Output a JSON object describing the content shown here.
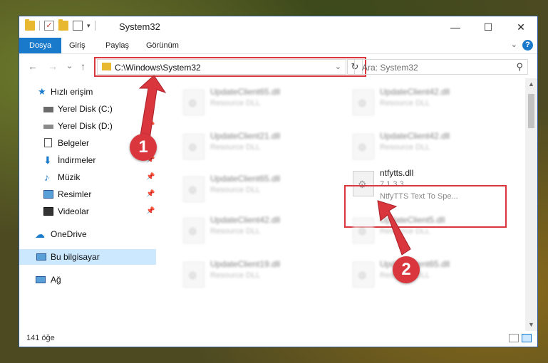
{
  "window": {
    "title": "System32"
  },
  "caption": {
    "minimize": "—",
    "maximize": "☐",
    "close": "✕"
  },
  "ribbon": {
    "tabs": [
      "Dosya",
      "Giriş",
      "Paylaş",
      "Görünüm"
    ],
    "help": "?",
    "expand": "⌄"
  },
  "nav": {
    "back": "←",
    "forward": "→",
    "recent": "⌄",
    "up": "↑",
    "refresh": "↻"
  },
  "address": {
    "path": "C:\\Windows\\System32",
    "dropdown": "⌄"
  },
  "search": {
    "placeholder": "Ara: System32",
    "icon": "⚲"
  },
  "sidebar": {
    "quick_access": "Hızlı erişim",
    "items": [
      {
        "label": "Yerel Disk (C:)",
        "icon": "drive-icon"
      },
      {
        "label": "Yerel Disk (D:)",
        "icon": "drive-icon"
      },
      {
        "label": "Belgeler",
        "icon": "documents-icon"
      },
      {
        "label": "İndirmeler",
        "icon": "downloads-icon"
      },
      {
        "label": "Müzik",
        "icon": "music-icon"
      },
      {
        "label": "Resimler",
        "icon": "pictures-icon"
      },
      {
        "label": "Videolar",
        "icon": "videos-icon"
      }
    ],
    "onedrive": "OneDrive",
    "this_pc": "Bu bilgisayar",
    "network": "Ağ"
  },
  "files": [
    {
      "name": "UpdateClient65.dll",
      "desc": "Resource DLL"
    },
    {
      "name": "UpdateClient42.dll",
      "desc": "Resource DLL"
    },
    {
      "name": "UpdateClient21.dll",
      "desc": "Resource DLL"
    },
    {
      "name": "UpdateClient42.dll",
      "desc": "Resource DLL"
    },
    {
      "name": "UpdateClient65.dll",
      "desc": "Resource DLL"
    },
    {
      "name": "ntfytts.dll",
      "version": "7.1.3.3",
      "desc": "NtfyTTS Text To Spe..."
    },
    {
      "name": "UpdateClient42.dll",
      "desc": "Resource DLL"
    },
    {
      "name": "UpdateClient5.dll",
      "desc": "Resource DLL"
    },
    {
      "name": "UpdateClient19.dll",
      "desc": "Resource DLL"
    },
    {
      "name": "UpdateClient65.dll",
      "desc": "Resource DLL"
    }
  ],
  "status": {
    "count": "141 öğe"
  },
  "callouts": {
    "one": "1",
    "two": "2"
  },
  "colors": {
    "accent": "#1979ca",
    "highlight": "#d9363e",
    "selected": "#cce8ff"
  }
}
